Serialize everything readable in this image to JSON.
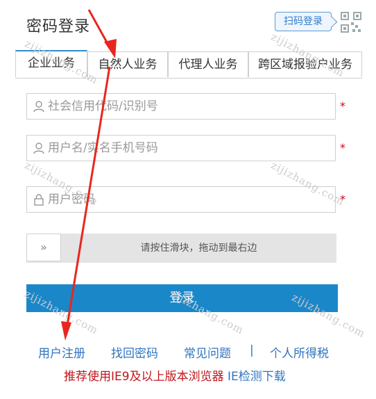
{
  "header": {
    "title": "密码登录",
    "scan_login_label": "扫码登录",
    "qr_icon": "qr-code-icon"
  },
  "tabs": [
    {
      "label": "企业业务",
      "active": true
    },
    {
      "label": "自然人业务",
      "active": false
    },
    {
      "label": "代理人业务",
      "active": false
    },
    {
      "label": "跨区域报验户业务",
      "active": false
    }
  ],
  "form": {
    "credit_code_placeholder": "社会信用代码/识别号",
    "username_placeholder": "用户名/实名手机号码",
    "password_placeholder": "用户密码",
    "required_mark": "*",
    "slider_handle": "»",
    "slider_hint": "请按住滑块，拖动到最右边",
    "login_label": "登录"
  },
  "links": {
    "register": "用户注册",
    "forgot_password": "找回密码",
    "faq": "常见问题",
    "separator": "|",
    "personal_tax": "个人所得税"
  },
  "notice": {
    "browser_text": "推荐使用IE9及以上版本浏览器",
    "ie_check": "IE检测下载"
  },
  "watermark": "zijizhang.com",
  "colors": {
    "accent": "#1a87c9",
    "link": "#2f74c0",
    "required": "#d0021b",
    "notice_red": "#c0161b",
    "annotation_arrow": "#e8261f"
  }
}
